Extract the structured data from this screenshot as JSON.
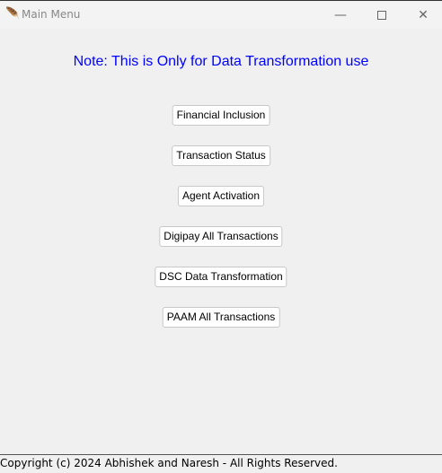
{
  "window": {
    "title": "Main Menu",
    "icon": "feather-icon"
  },
  "note": "Note: This is Only for Data Transformation use",
  "note_color": "#0000ff",
  "buttons": [
    "Financial Inclusion",
    "Transaction Status",
    "Agent Activation",
    "Digipay All Transactions",
    "DSC Data Transformation",
    "PAAM All Transactions"
  ],
  "footer": "Copyright (c) 2024 Abhishek and Naresh - All Rights Reserved."
}
